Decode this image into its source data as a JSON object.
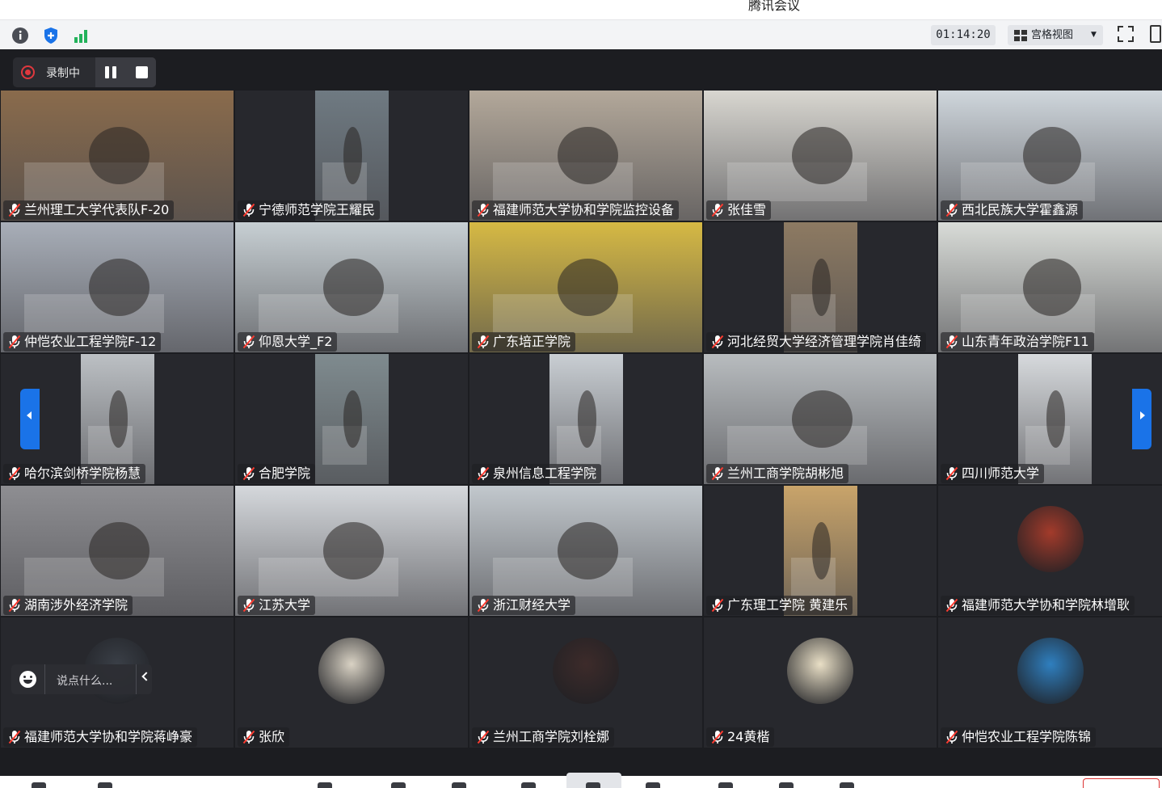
{
  "window": {
    "title": "腾讯会议"
  },
  "infobar": {
    "icons": [
      "info-icon",
      "shield-icon",
      "signal-icon"
    ],
    "timer": "01:14:20",
    "view_label": "宫格视图",
    "view_caret": "▼"
  },
  "recording": {
    "label": "录制中"
  },
  "chat": {
    "placeholder": "说点什么..."
  },
  "participants": [
    {
      "name": "兰州理工大学代表队F-20",
      "bg": "#8a6b4c"
    },
    {
      "name": "宁德师范学院王耀民",
      "bg": "#6f7a82"
    },
    {
      "name": "福建师范大学协和学院监控设备",
      "bg": "#b3a89a"
    },
    {
      "name": "张佳雪",
      "bg": "#d8d6d0"
    },
    {
      "name": "西北民族大学霍鑫源",
      "bg": "#cfd6dc"
    },
    {
      "name": "仲恺农业工程学院F-12",
      "bg": "#a8aeb8"
    },
    {
      "name": "仰恩大学_F2",
      "bg": "#c7cfd3"
    },
    {
      "name": "广东培正学院",
      "bg": "#d6b944"
    },
    {
      "name": "河北经贸大学经济管理学院肖佳绮",
      "bg": "#8d7a62"
    },
    {
      "name": "山东青年政治学院F11",
      "bg": "#d9dcd8"
    },
    {
      "name": "哈尔滨剑桥学院杨慧",
      "bg": "#bcc0c4"
    },
    {
      "name": "合肥学院",
      "bg": "#7f8b8f"
    },
    {
      "name": "泉州信息工程学院",
      "bg": "#c9ced3"
    },
    {
      "name": "兰州工商学院胡彬旭",
      "bg": "#b8bcbf"
    },
    {
      "name": "四川师范大学",
      "bg": "#d7dadd"
    },
    {
      "name": "湖南涉外经济学院",
      "bg": "#8e8e92"
    },
    {
      "name": "江苏大学",
      "bg": "#d5d8dc"
    },
    {
      "name": "浙江财经大学",
      "bg": "#c2c8cd"
    },
    {
      "name": "广东理工学院 黄建乐",
      "bg": "#c9a46a"
    },
    {
      "name": "福建师范大学协和学院林增耿",
      "avatar": "#a33b2b"
    },
    {
      "name": "福建师范大学协和学院蒋峥豪",
      "avatar": "#3a3f47"
    },
    {
      "name": "张欣",
      "avatar": "#d9d2c4"
    },
    {
      "name": "兰州工商学院刘栓娜",
      "avatar": "#3d2b2a"
    },
    {
      "name": "24黄楷",
      "avatar": "#e9dfc6"
    },
    {
      "name": "仲恺农业工程学院陈锦",
      "avatar": "#2f7fbf"
    }
  ],
  "toolbar": {
    "icons": [
      "mute-mic-icon",
      "stop-video-icon",
      "share-screen-icon",
      "security-icon",
      "members-icon",
      "invite-icon",
      "apps-icon",
      "record-icon",
      "chat-icon",
      "layout-icon",
      "settings-icon"
    ]
  },
  "colors": {
    "accent": "#1a73e8",
    "rec": "#e0383e",
    "background": "#1c1d21"
  }
}
